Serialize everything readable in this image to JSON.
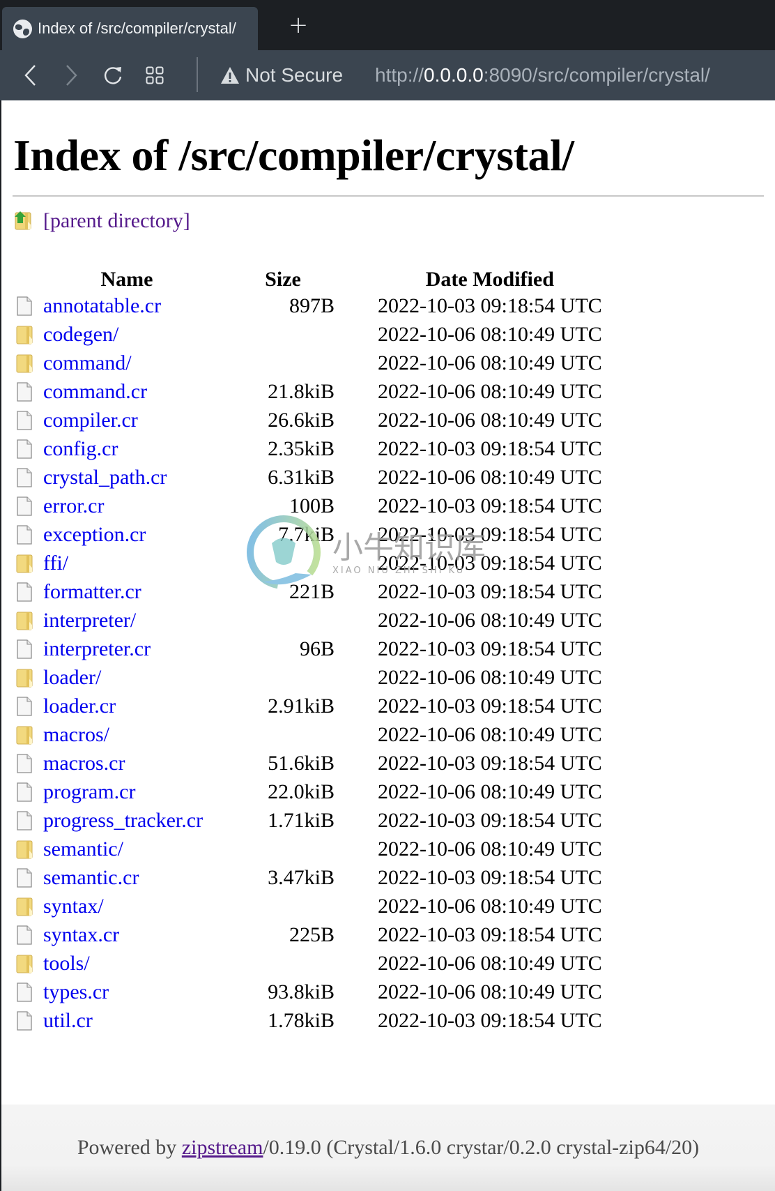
{
  "browser": {
    "tab_title": "Index of /src/compiler/crystal/",
    "new_tab_label": "+",
    "security_label": "Not Secure",
    "url_scheme": "http://",
    "url_host": "0.0.0.0",
    "url_rest": ":8090/src/compiler/crystal/",
    "icons": {
      "favicon": "globe-icon",
      "back": "chevron-left-icon",
      "forward": "chevron-right-icon",
      "reload": "reload-icon",
      "tabs": "grid-icon",
      "security": "warning-icon"
    }
  },
  "page": {
    "title": "Index of /src/compiler/crystal/",
    "parent_link": "[parent directory]",
    "columns": {
      "name": "Name",
      "size": "Size",
      "date": "Date Modified"
    },
    "entries": [
      {
        "name": "annotatable.cr",
        "type": "file",
        "size": "897B",
        "date": "2022-10-03 09:18:54 UTC"
      },
      {
        "name": "codegen/",
        "type": "folder",
        "size": "",
        "date": "2022-10-06 08:10:49 UTC"
      },
      {
        "name": "command/",
        "type": "folder",
        "size": "",
        "date": "2022-10-06 08:10:49 UTC"
      },
      {
        "name": "command.cr",
        "type": "file",
        "size": "21.8kiB",
        "date": "2022-10-06 08:10:49 UTC"
      },
      {
        "name": "compiler.cr",
        "type": "file",
        "size": "26.6kiB",
        "date": "2022-10-06 08:10:49 UTC"
      },
      {
        "name": "config.cr",
        "type": "file",
        "size": "2.35kiB",
        "date": "2022-10-03 09:18:54 UTC"
      },
      {
        "name": "crystal_path.cr",
        "type": "file",
        "size": "6.31kiB",
        "date": "2022-10-06 08:10:49 UTC"
      },
      {
        "name": "error.cr",
        "type": "file",
        "size": "100B",
        "date": "2022-10-03 09:18:54 UTC"
      },
      {
        "name": "exception.cr",
        "type": "file",
        "size": "7.7kiB",
        "date": "2022-10-03 09:18:54 UTC"
      },
      {
        "name": "ffi/",
        "type": "folder",
        "size": "",
        "date": "2022-10-03 09:18:54 UTC"
      },
      {
        "name": "formatter.cr",
        "type": "file",
        "size": "221B",
        "date": "2022-10-03 09:18:54 UTC"
      },
      {
        "name": "interpreter/",
        "type": "folder",
        "size": "",
        "date": "2022-10-06 08:10:49 UTC"
      },
      {
        "name": "interpreter.cr",
        "type": "file",
        "size": "96B",
        "date": "2022-10-03 09:18:54 UTC"
      },
      {
        "name": "loader/",
        "type": "folder",
        "size": "",
        "date": "2022-10-06 08:10:49 UTC"
      },
      {
        "name": "loader.cr",
        "type": "file",
        "size": "2.91kiB",
        "date": "2022-10-03 09:18:54 UTC"
      },
      {
        "name": "macros/",
        "type": "folder",
        "size": "",
        "date": "2022-10-06 08:10:49 UTC"
      },
      {
        "name": "macros.cr",
        "type": "file",
        "size": "51.6kiB",
        "date": "2022-10-03 09:18:54 UTC"
      },
      {
        "name": "program.cr",
        "type": "file",
        "size": "22.0kiB",
        "date": "2022-10-06 08:10:49 UTC"
      },
      {
        "name": "progress_tracker.cr",
        "type": "file",
        "size": "1.71kiB",
        "date": "2022-10-03 09:18:54 UTC"
      },
      {
        "name": "semantic/",
        "type": "folder",
        "size": "",
        "date": "2022-10-06 08:10:49 UTC"
      },
      {
        "name": "semantic.cr",
        "type": "file",
        "size": "3.47kiB",
        "date": "2022-10-03 09:18:54 UTC"
      },
      {
        "name": "syntax/",
        "type": "folder",
        "size": "",
        "date": "2022-10-06 08:10:49 UTC"
      },
      {
        "name": "syntax.cr",
        "type": "file",
        "size": "225B",
        "date": "2022-10-03 09:18:54 UTC"
      },
      {
        "name": "tools/",
        "type": "folder",
        "size": "",
        "date": "2022-10-06 08:10:49 UTC"
      },
      {
        "name": "types.cr",
        "type": "file",
        "size": "93.8kiB",
        "date": "2022-10-06 08:10:49 UTC"
      },
      {
        "name": "util.cr",
        "type": "file",
        "size": "1.78kiB",
        "date": "2022-10-03 09:18:54 UTC"
      }
    ]
  },
  "footer": {
    "prefix": "Powered by ",
    "link": "zipstream",
    "suffix": "/0.19.0 (Crystal/1.6.0 crystar/0.2.0 crystal-zip64/20)"
  },
  "watermark": {
    "text": "小牛知识库",
    "subtext": "XIAO NIU ZHI SHI KU"
  }
}
